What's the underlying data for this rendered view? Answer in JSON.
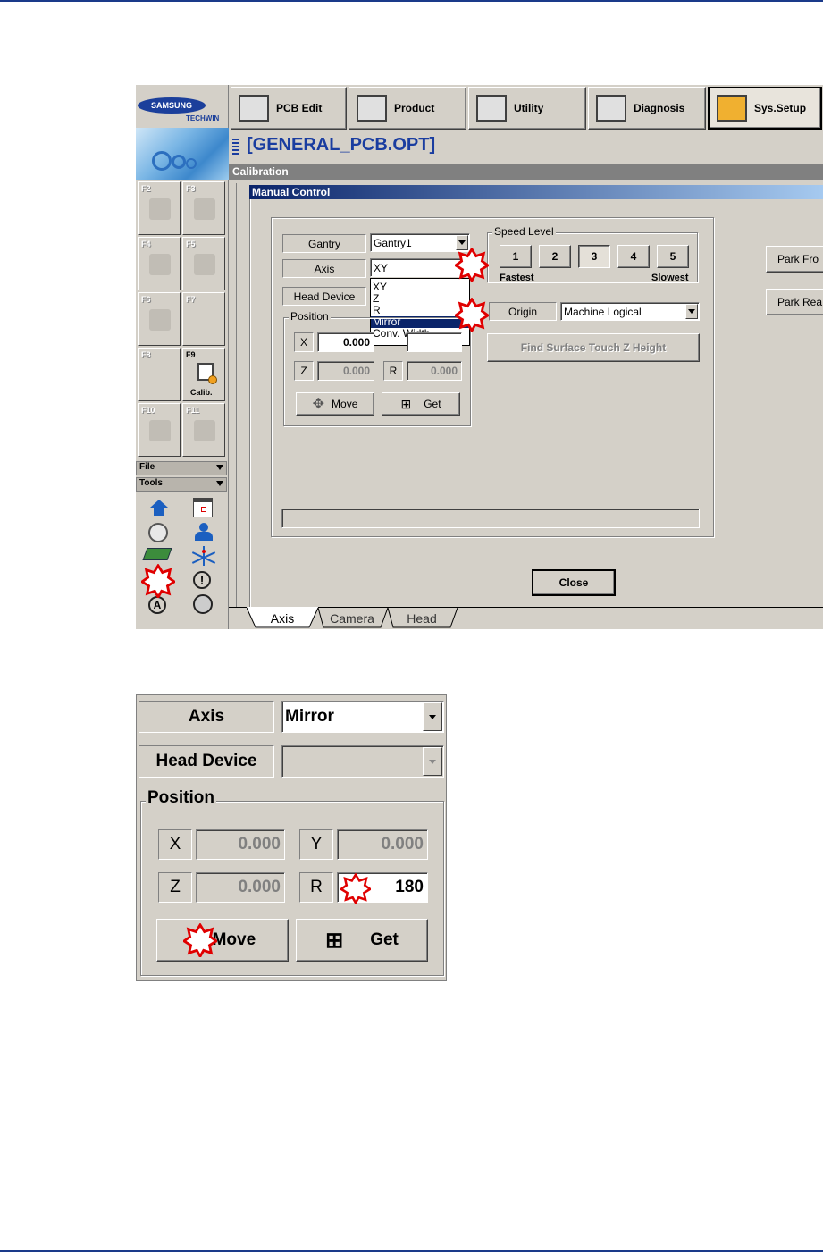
{
  "brand": {
    "name": "SAMSUNG",
    "sub": "TECHWIN"
  },
  "toolbar": [
    "PCB Edit",
    "Product",
    "Utility",
    "Diagnosis",
    "Sys.Setup"
  ],
  "file_title": "[GENERAL_PCB.OPT]",
  "section_title": "Calibration",
  "dialog_title": "Manual Control",
  "fkeys": [
    "F2",
    "F3",
    "F4",
    "F5",
    "F6",
    "F7",
    "F8",
    "F9",
    "F10",
    "F11"
  ],
  "f9_caption": "Calib.",
  "menus": {
    "file": "File",
    "tools": "Tools"
  },
  "labels": {
    "gantry": "Gantry",
    "axis": "Axis",
    "head_device": "Head Device",
    "position": "Position",
    "speed_level": "Speed Level",
    "fastest": "Fastest",
    "slowest": "Slowest",
    "origin": "Origin"
  },
  "gantry_value": "Gantry1",
  "axis_value": "XY",
  "axis_options": [
    "XY",
    "Z",
    "R",
    "Mirror",
    "Conv. Width"
  ],
  "axis_selected_index": 3,
  "origin_value": "Machine Logical",
  "speed_levels": [
    "1",
    "2",
    "3",
    "4",
    "5"
  ],
  "speed_selected": "3",
  "pos": {
    "x_label": "X",
    "x_value": "0.000",
    "z_label": "Z",
    "z_value": "0.000",
    "r_label": "R",
    "r_value": "0.000"
  },
  "buttons": {
    "move": "Move",
    "get": "Get",
    "find_surface": "Find Surface Touch Z Height",
    "park_front": "Park Fro",
    "park_rear": "Park Rea",
    "close": "Close"
  },
  "tabs": [
    "Axis",
    "Camera",
    "Head"
  ],
  "zoom": {
    "axis_label": "Axis",
    "axis_value": "Mirror",
    "head_device_label": "Head Device",
    "position_label": "Position",
    "x_label": "X",
    "x_value": "0.000",
    "y_label": "Y",
    "y_value": "0.000",
    "z_label": "Z",
    "z_value": "0.000",
    "r_label": "R",
    "r_value": "180",
    "move": "Move",
    "get": "Get"
  },
  "colors": {
    "accent_blue": "#0a246a",
    "title_blue": "#1a3da0",
    "highlight_star": "#e00000"
  }
}
